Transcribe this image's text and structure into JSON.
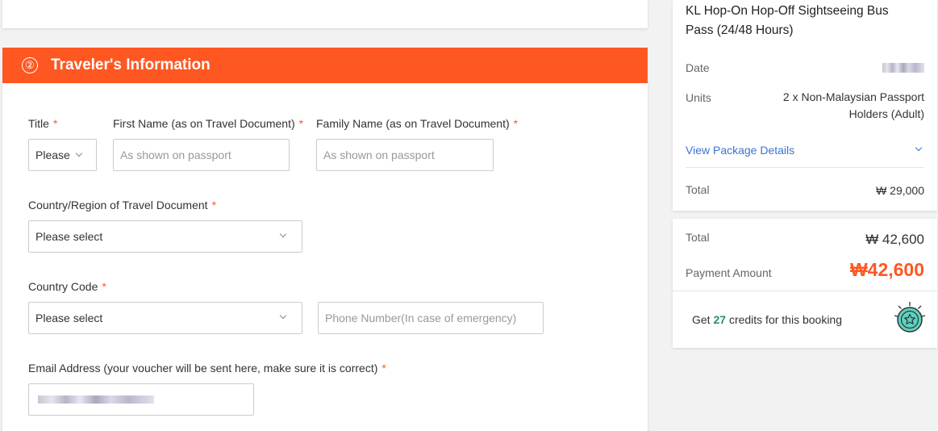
{
  "section": {
    "step": "②",
    "title": "Traveler's Information"
  },
  "form": {
    "title_label": "Title",
    "title_value": "Please",
    "first_name_label": "First Name (as on Travel Document)",
    "first_name_placeholder": "As shown on passport",
    "family_name_label": "Family Name (as on Travel Document)",
    "family_name_placeholder": "As shown on passport",
    "country_doc_label": "Country/Region of Travel Document",
    "country_doc_value": "Please select",
    "country_code_label": "Country Code",
    "country_code_value": "Please select",
    "phone_placeholder": "Phone Number(In case of emergency)",
    "email_label": "Email Address (your voucher will be sent here, make sure it is correct)",
    "required_mark": "*"
  },
  "summary": {
    "product_title": "KL Hop-On Hop-Off Sightseeing Bus Pass (24/48 Hours)",
    "date_label": "Date",
    "units_label": "Units",
    "units_value": "2 x Non-Malaysian Passport Holders (Adult)",
    "view_details": "View Package Details",
    "total_label": "Total",
    "total_value": "₩ 29,000"
  },
  "payment": {
    "total_label": "Total",
    "total_value": "₩ 42,600",
    "amount_label": "Payment Amount",
    "amount_value": "₩42,600",
    "credits_prefix": "Get",
    "credits_count": "27",
    "credits_suffix": "credits for this booking"
  },
  "colors": {
    "accent": "#ff5722",
    "link": "#3b73d4",
    "credits": "#2e8b7a"
  },
  "icons": {
    "chevron": "chevron-down-icon",
    "badge": "star-medal-icon"
  }
}
